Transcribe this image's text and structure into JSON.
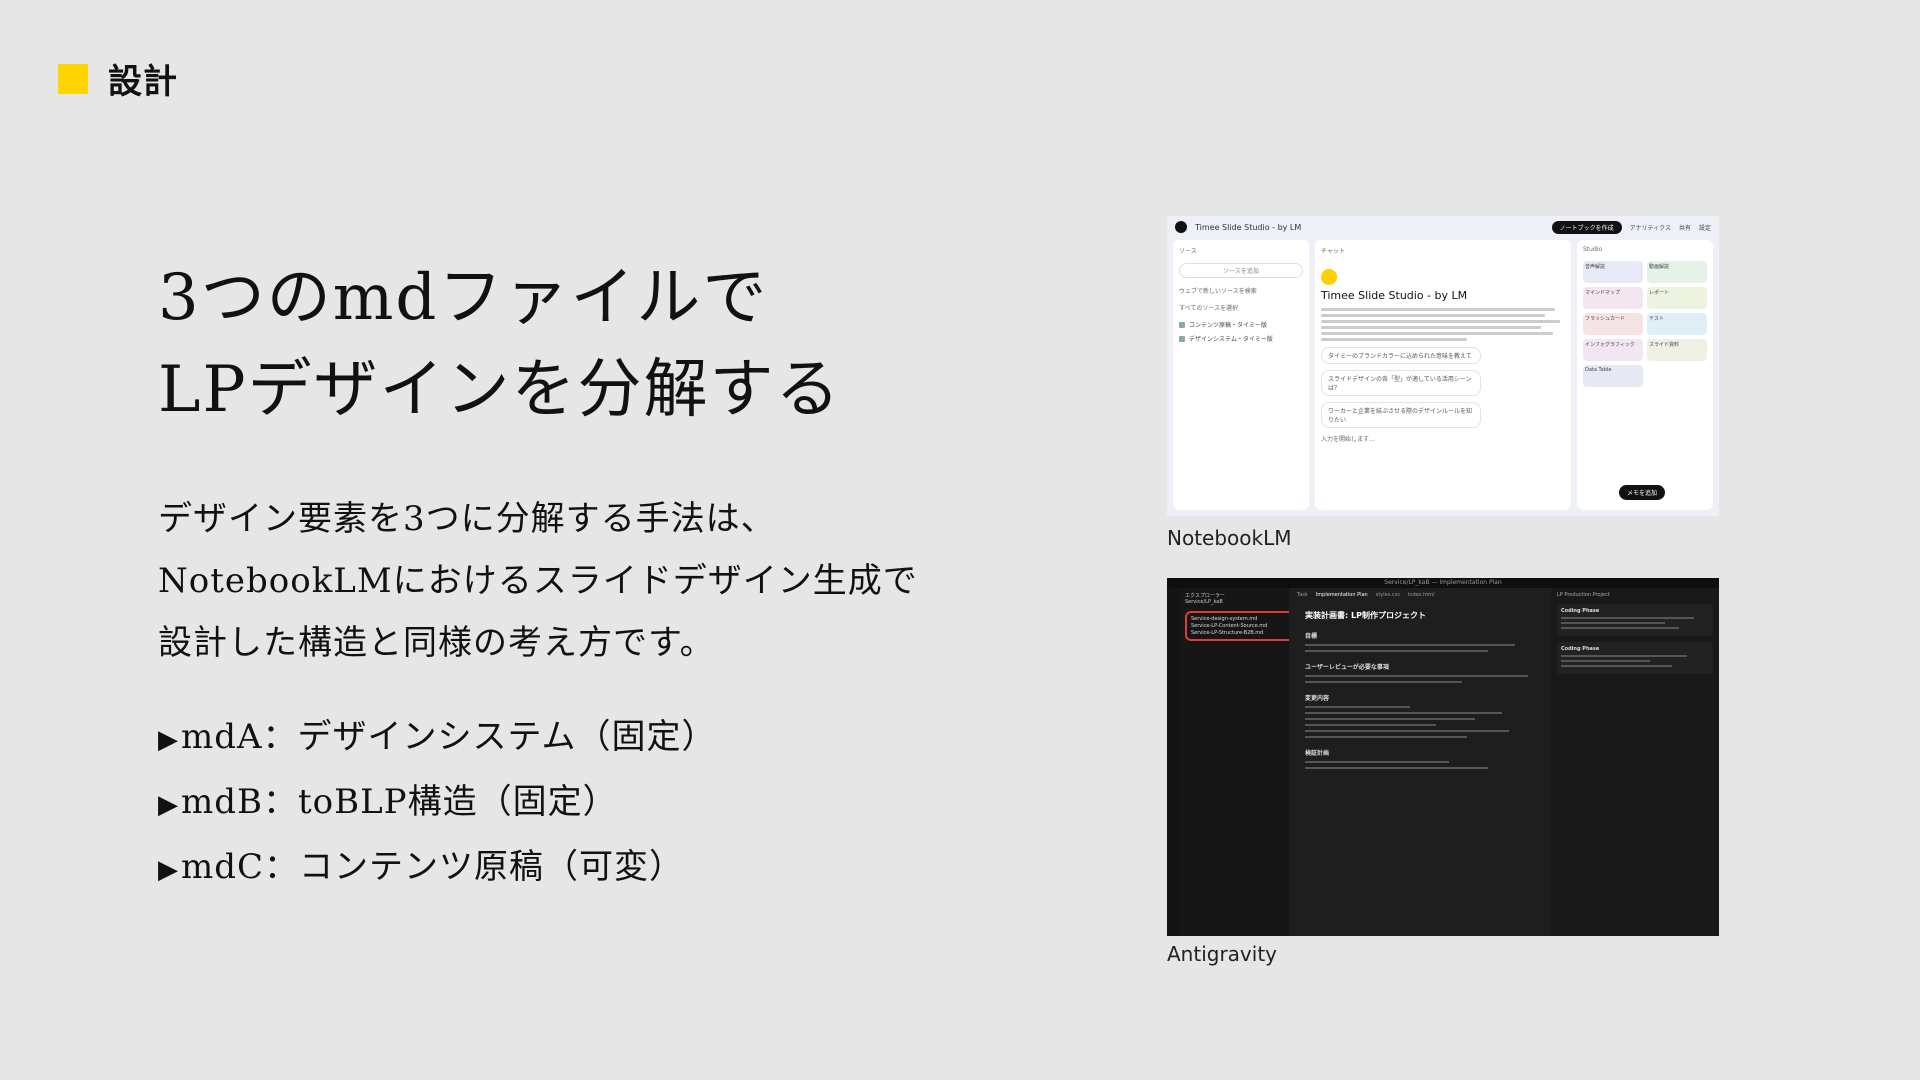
{
  "header": {
    "section_label": "設計"
  },
  "title": {
    "line1": "3つのmdファイルで",
    "line2": "LPデザインを分解する"
  },
  "body": {
    "line1": "デザイン要素を3つに分解する手法は、",
    "line2": "NotebookLMにおけるスライドデザイン生成で",
    "line3": "設計した構造と同様の考え方です。"
  },
  "bullets": [
    {
      "arrow": "▶",
      "text": "mdA：デザインシステム（固定）"
    },
    {
      "arrow": "▶",
      "text": "mdB：toBLP構造（固定）"
    },
    {
      "arrow": "▶",
      "text": "mdC：コンテンツ原稿（可変）"
    }
  ],
  "screenshots": {
    "notebooklm": {
      "caption": "NotebookLM",
      "window_title": "Timee Slide Studio - by LM",
      "create_button": "ノートブックを作成",
      "tools": [
        "アナリティクス",
        "共有",
        "設定"
      ],
      "sources_header": "ソース",
      "add_source": "ソースを追加",
      "search_placeholder": "ウェブで新しいソースを検索",
      "select_all": "すべてのソースを選択",
      "source_items": [
        "コンテンツ原稿・タイミー版",
        "デザインシステム・タイミー版"
      ],
      "chat_header": "チャット",
      "chat_title": "Timee Slide Studio - by LM",
      "suggestions": [
        "タイミーのブランドカラーに込められた意味を教えて",
        "スライドデザインの各「型」が適している活用シーンは？",
        "ワーカーと企業を結ぶさせる際のデザインルールを知りたい"
      ],
      "input_placeholder": "入力を開始します...",
      "studio_header": "Studio",
      "studio_tiles": [
        "音声解説",
        "動画解説",
        "マインドマップ",
        "レポート",
        "フラッシュカード",
        "テスト",
        "インフォグラフィック",
        "スライド資料",
        "Data Table"
      ],
      "add_note": "メモを追加"
    },
    "antigravity": {
      "caption": "Antigravity",
      "window_title": "Service/LP_kaB — Implementation Plan",
      "explorer_label": "エクスプローラー",
      "folder": "Service/LP_kaB",
      "files": [
        "Service-design-system.md",
        "Service-LP-Content-Source.md",
        "Service-LP-Structure-B2B.md"
      ],
      "tabs": [
        "Task",
        "Implementation Plan",
        "styles.css",
        "index.html"
      ],
      "plan_title": "実装計画書: LP制作プロジェクト",
      "sections": [
        "目標",
        "ユーザーレビューが必要な事項",
        "変更内容",
        "検証計画"
      ],
      "agent_panel": "LP Production Project",
      "agent_cards": [
        "Coding Phase",
        "Coding Phase"
      ]
    }
  }
}
